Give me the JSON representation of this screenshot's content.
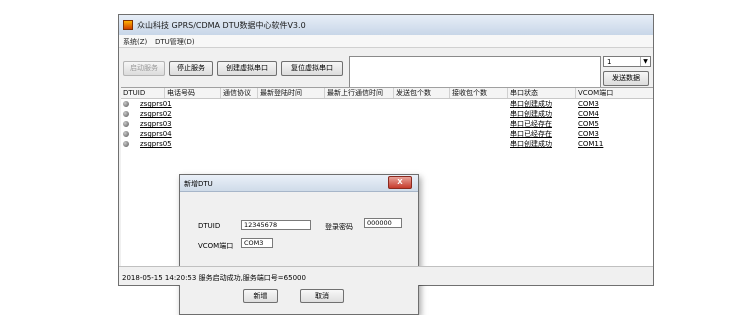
{
  "window": {
    "title": "众山科技 GPRS/CDMA DTU数据中心软件V3.0"
  },
  "menu": {
    "items": [
      {
        "label": "系统(Z)"
      },
      {
        "label": "DTU管理(D)"
      }
    ]
  },
  "toolbar": {
    "start_label": "启动服务",
    "stop_label": "停止服务",
    "create_port_label": "创建虚拟串口",
    "reset_port_label": "复位虚拟串口",
    "send_label": "发送数据",
    "port_select_value": "1"
  },
  "table": {
    "columns": [
      "DTUID",
      "电话号码",
      "通信协议",
      "最新登陆时间",
      "最新上行通信时间",
      "发送包个数",
      "接收包个数",
      "串口状态",
      "VCOM端口"
    ],
    "rows": [
      {
        "dtuid": "zsgprs01",
        "status": "串口创建成功",
        "vcom": "COM3"
      },
      {
        "dtuid": "zsgprs02",
        "status": "串口创建成功",
        "vcom": "COM4"
      },
      {
        "dtuid": "zsgprs03",
        "status": "串口已经存在",
        "vcom": "COM5"
      },
      {
        "dtuid": "zsgprs04",
        "status": "串口已经存在",
        "vcom": "COM3"
      },
      {
        "dtuid": "zsgprs05",
        "status": "串口创建成功",
        "vcom": "COM11"
      }
    ]
  },
  "status_bar": {
    "text": "2018-05-15 14:20:53 服务启动成功,服务端口号=65000"
  },
  "dialog": {
    "title": "新增DTU",
    "close_label": "X",
    "dtuid_label": "DTUID",
    "dtuid_value": "12345678",
    "password_label": "登录密码",
    "password_value": "000000",
    "vcom_label": "VCOM端口",
    "vcom_value": "COM3",
    "add_label": "新增",
    "cancel_label": "取消"
  }
}
